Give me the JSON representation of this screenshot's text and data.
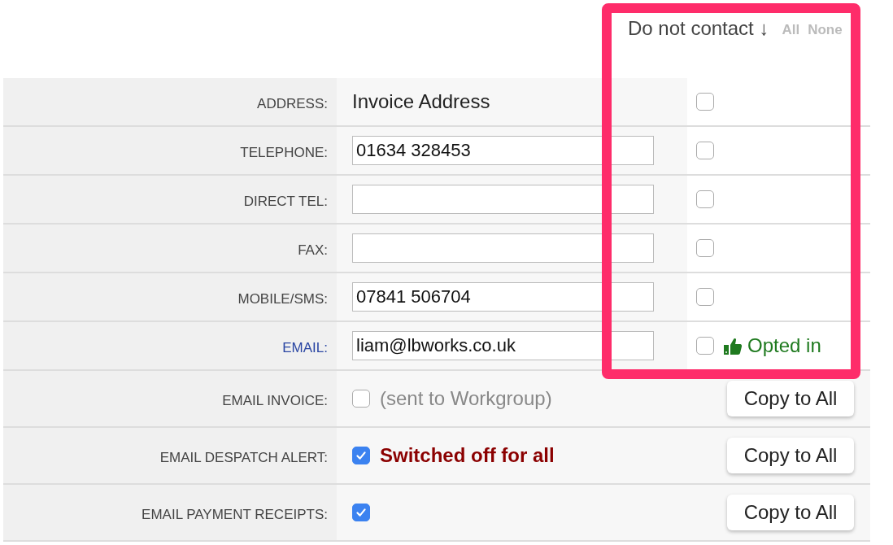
{
  "contact_header": {
    "title": "Do not contact",
    "arrow": "↓",
    "select_all": "All",
    "select_none": "None"
  },
  "channels": [
    {
      "label": {
        "text": "ADDRESS:",
        "kind": "plain"
      },
      "kind": "text",
      "value": "Invoice Address",
      "do_not_contact": false
    },
    {
      "label": {
        "text": "TELEPHONE:",
        "kind": "plain"
      },
      "kind": "input",
      "value": "01634 328453",
      "do_not_contact": false
    },
    {
      "label": {
        "text": "DIRECT TEL:",
        "kind": "plain"
      },
      "kind": "input",
      "do_not_contact": false
    },
    {
      "label": {
        "text": "FAX:",
        "kind": "plain"
      },
      "kind": "input",
      "do_not_contact": false
    },
    {
      "label": {
        "text": "MOBILE/SMS:",
        "kind": "plain"
      },
      "kind": "input",
      "value": "07841 506704",
      "do_not_contact": false
    },
    {
      "label": {
        "text": "EMAIL:",
        "kind": "link"
      },
      "kind": "input",
      "value": "liam@lbworks.co.uk",
      "do_not_contact": false,
      "status": "Opted in"
    }
  ],
  "email_options": [
    {
      "label": "EMAIL INVOICE:",
      "checked": false,
      "note": {
        "text": "(sent to Workgroup)",
        "kind": "muted"
      },
      "button": "Copy to All"
    },
    {
      "label": "EMAIL DESPATCH ALERT:",
      "checked": true,
      "note": {
        "text": "Switched off for all",
        "kind": "alert"
      },
      "button": "Copy to All"
    },
    {
      "label": "EMAIL PAYMENT RECEIPTS:",
      "checked": true,
      "button": "Copy to All"
    }
  ],
  "annotation": {
    "kind": "frame"
  }
}
